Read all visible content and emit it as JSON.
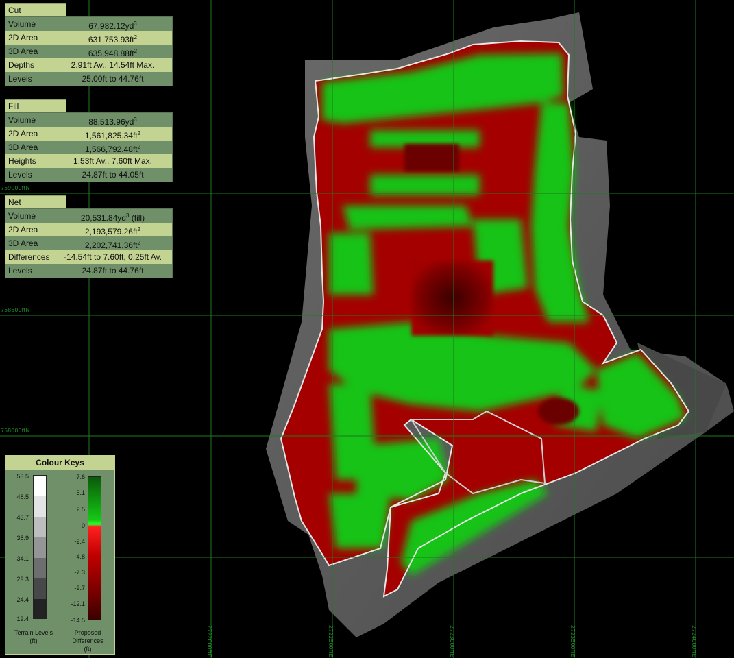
{
  "panels": [
    {
      "name": "Cut",
      "rows": [
        {
          "label": "Volume",
          "value": "67,982.12yd",
          "sup": "3"
        },
        {
          "label": "2D Area",
          "value": "631,753.93ft",
          "sup": "2"
        },
        {
          "label": "3D Area",
          "value": "635,948.88ft",
          "sup": "2"
        },
        {
          "label": "Depths",
          "value": "2.91ft Av., 14.54ft Max.",
          "sup": ""
        },
        {
          "label": "Levels",
          "value": "25.00ft to 44.76ft",
          "sup": ""
        }
      ]
    },
    {
      "name": "Fill",
      "rows": [
        {
          "label": "Volume",
          "value": "88,513.96yd",
          "sup": "3"
        },
        {
          "label": "2D Area",
          "value": "1,561,825.34ft",
          "sup": "2"
        },
        {
          "label": "3D Area",
          "value": "1,566,792.48ft",
          "sup": "2"
        },
        {
          "label": "Heights",
          "value": "1.53ft Av., 7.60ft Max.",
          "sup": ""
        },
        {
          "label": "Levels",
          "value": "24.87ft to 44.05ft",
          "sup": ""
        }
      ]
    },
    {
      "name": "Net",
      "rows": [
        {
          "label": "Volume",
          "value": "20,531.84yd",
          "sup": "3",
          "suffix": " (fill)"
        },
        {
          "label": "2D Area",
          "value": "2,193,579.26ft",
          "sup": "2"
        },
        {
          "label": "3D Area",
          "value": "2,202,741.36ft",
          "sup": "2"
        },
        {
          "label": "Differences",
          "value": "-14.54ft to 7.60ft, 0.25ft Av.",
          "sup": ""
        },
        {
          "label": "Levels",
          "value": "24.87ft to 44.76ft",
          "sup": ""
        }
      ]
    }
  ],
  "grid_labels": {
    "northing": [
      "759000ftN",
      "758500ftN",
      "758000ftN"
    ],
    "easting": [
      "2722000ftE",
      "2722500ftE",
      "2723000ftE",
      "2723500ftE",
      "2724000ftE"
    ]
  },
  "colour_keys": {
    "title": "Colour Keys",
    "terrain_ticks": [
      "53.5",
      "48.5",
      "43.7",
      "38.9",
      "34.1",
      "29.3",
      "24.4",
      "19.4"
    ],
    "terrain_caption_1": "Terrain Levels",
    "terrain_caption_2": "(ft)",
    "diff_ticks": [
      "7.6",
      "5.1",
      "2.5",
      "0",
      "-2.4",
      "-4.8",
      "-7.3",
      "-9.7",
      "-12.1",
      "-14.5"
    ],
    "diff_caption_1": "Proposed",
    "diff_caption_2": "Differences",
    "diff_caption_3": "(ft)"
  },
  "colors": {
    "cut": "#a80000",
    "fill": "#14c814",
    "grid": "#1e7a1e",
    "panel_light": "#c3d392",
    "panel_dark": "#6f9068"
  }
}
